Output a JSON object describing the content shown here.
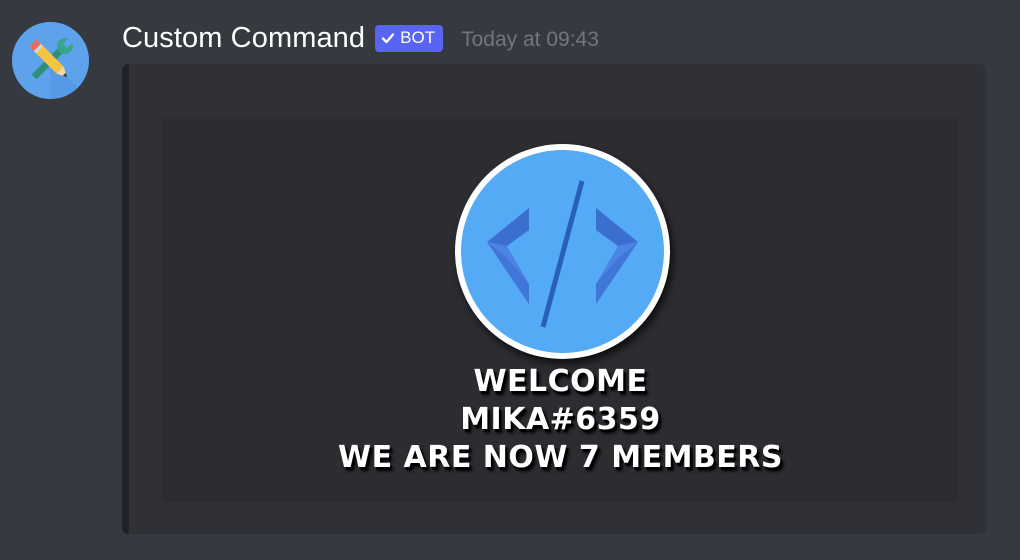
{
  "message": {
    "author": {
      "username": "Custom Command",
      "bot_tag": "BOT",
      "avatar_icon": "tools-pencil-wrench-icon"
    },
    "timestamp": "Today at 09:43",
    "embed": {
      "image": {
        "logo_icon": "code-brackets-icon",
        "lines": [
          "WELCOME",
          "MIKA#6359",
          "WE ARE NOW 7 MEMBERS"
        ]
      }
    }
  },
  "colors": {
    "background": "#36393f",
    "embed_bg": "#2f3136",
    "bot_tag": "#5865f2",
    "logo_blue": "#55aaf5"
  }
}
